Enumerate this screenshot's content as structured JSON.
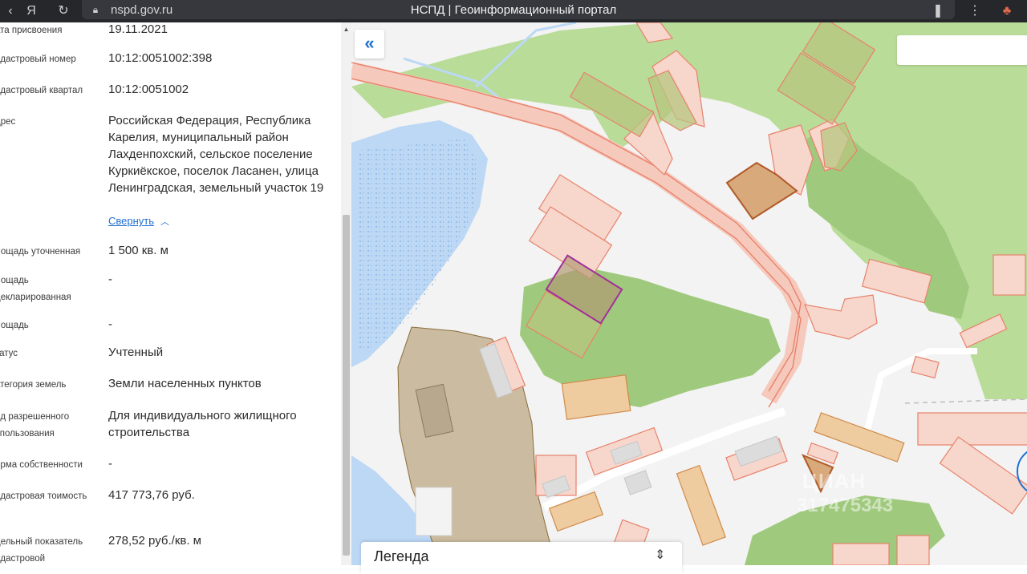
{
  "browser": {
    "url": "nspd.gov.ru",
    "title": "НСПД | Геоинформационный портал"
  },
  "panel": {
    "fields": [
      {
        "label": "ата присвоения",
        "value": "19.11.2021"
      },
      {
        "label": "адастровый номер",
        "value": "10:12:0051002:398"
      },
      {
        "label": "адастровый квартал",
        "value": "10:12:0051002"
      },
      {
        "label": "дрес",
        "value": "Российская Федерация, Республика Карелия, муниципальный район Лахденпохский, сельское поселение Куркиёкское, поселок Ласанен, улица Ленинградская, земельный участок 19"
      },
      {
        "label": "лощадь уточненная",
        "value": "1 500 кв. м"
      },
      {
        "label": "лощадь декларированная",
        "value": "-"
      },
      {
        "label": "лощадь",
        "value": "-"
      },
      {
        "label": "татус",
        "value": "Учтенный"
      },
      {
        "label": "атегория земель",
        "value": "Земли населенных пунктов"
      },
      {
        "label": "ид разрешенного спользования",
        "value": "Для индивидуального жилищного строительства"
      },
      {
        "label": "орма собственности",
        "value": "-"
      },
      {
        "label": "адастровая тоимость",
        "value": "417 773,76 руб."
      },
      {
        "label": "дельный показатель адастровой",
        "value": "278,52 руб./кв. м"
      }
    ],
    "collapse_label": "Свернуть"
  },
  "map": {
    "legend_title": "Легенда",
    "watermark_brand": "ЦИАН",
    "watermark_phone": "317475343"
  },
  "colors": {
    "water": "#bcd8f5",
    "forest": "#a9cc88",
    "parcel_stroke": "#e8826b",
    "parcel_fill": "#f7d6cc",
    "selected": "#a0309a",
    "accent": "#1f6fd1"
  },
  "icons": [
    "yandex-icon",
    "refresh-icon",
    "lock-icon",
    "bookmark-icon",
    "menu-icon",
    "extension-icon",
    "double-chevron-left-icon",
    "chevron-up-icon",
    "sort-icon"
  ]
}
